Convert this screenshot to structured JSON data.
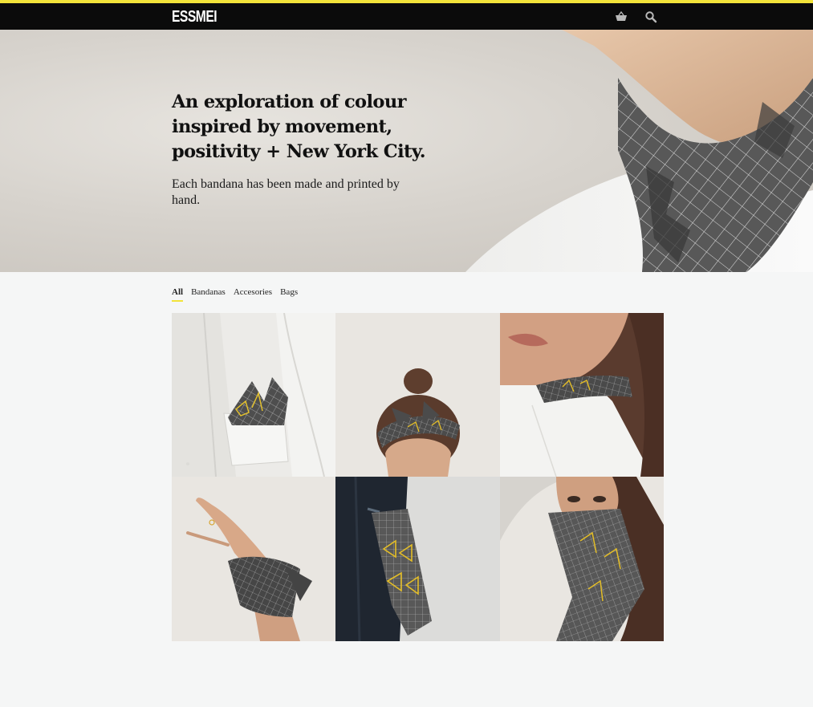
{
  "header": {
    "logo": "ESSMEI",
    "icons": [
      "basket-icon",
      "search-icon"
    ],
    "accent_color": "#f2e33a",
    "bar_color": "#0b0b0b"
  },
  "hero": {
    "title": "An exploration of colour inspired by movement, positivity + New York City.",
    "subtitle": "Each bandana has been made and printed by hand."
  },
  "filters": {
    "items": [
      {
        "label": "All",
        "active": true
      },
      {
        "label": "Bandanas",
        "active": false
      },
      {
        "label": "Accesories",
        "active": false
      },
      {
        "label": "Bags",
        "active": false
      }
    ]
  },
  "products": [
    {
      "name": "pocket-square-photo"
    },
    {
      "name": "headband-photo"
    },
    {
      "name": "neckerchief-photo"
    },
    {
      "name": "wrist-tie-photo"
    },
    {
      "name": "back-pocket-photo"
    },
    {
      "name": "face-mask-photo"
    }
  ]
}
